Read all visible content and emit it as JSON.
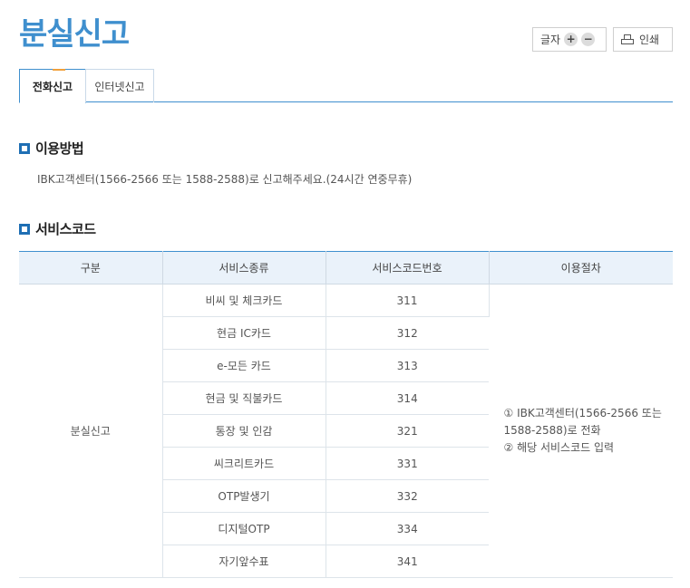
{
  "page": {
    "title": "분실신고"
  },
  "toolbar": {
    "font_label": "글자",
    "font_increase": "+",
    "font_decrease": "−",
    "print_label": "인쇄"
  },
  "tabs": [
    {
      "label": "전화신고",
      "active": true
    },
    {
      "label": "인터넷신고",
      "active": false
    }
  ],
  "usage": {
    "heading": "이용방법",
    "text": "IBK고객센터(1566-2566 또는 1588-2588)로 신고해주세요.(24시간 연중무휴)"
  },
  "service_codes": {
    "heading": "서비스코드",
    "columns": [
      "구분",
      "서비스종류",
      "서비스코드번호",
      "이용절차"
    ],
    "category": "분실신고",
    "rows": [
      {
        "service": "비씨 및 체크카드",
        "code": "311"
      },
      {
        "service": "현금 IC카드",
        "code": "312"
      },
      {
        "service": "e-모든 카드",
        "code": "313"
      },
      {
        "service": "현금 및 직불카드",
        "code": "314"
      },
      {
        "service": "통장 및 인감",
        "code": "321"
      },
      {
        "service": "씨크리트카드",
        "code": "331"
      },
      {
        "service": "OTP발생기",
        "code": "332"
      },
      {
        "service": "디지털OTP",
        "code": "334"
      },
      {
        "service": "자기앞수표",
        "code": "341"
      }
    ],
    "procedure": {
      "line1": "① IBK고객센터(1566-2566 또는",
      "line2": "1588-2588)로 전화",
      "line3": "② 해당 서비스코드 입력"
    }
  }
}
